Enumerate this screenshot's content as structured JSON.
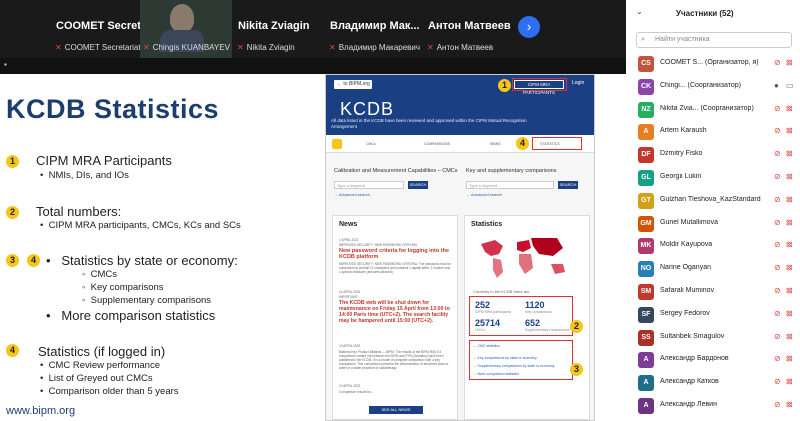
{
  "video_tiles": [
    {
      "name": "COOMET Secretariat",
      "label": "COOMET Secretariat",
      "muted": true
    },
    {
      "name": "",
      "label": "Chingis KUANBAYEV",
      "muted": true
    },
    {
      "name": "Nikita Zviagin",
      "label": "Nikita Zviagin",
      "muted": true
    },
    {
      "name": "Владимир Мак...",
      "label": "Владимир Макаревич",
      "muted": true
    },
    {
      "name": "Антон Матвеев",
      "label": "Антон Матвеев",
      "muted": true
    }
  ],
  "next_icon": "chevron-right-icon",
  "slide": {
    "title": "KCDB Statistics",
    "sections": [
      {
        "badge": "1",
        "heading": "CIPM MRA Participants",
        "bullets": [
          "NMIs, DIs, and IOs"
        ]
      },
      {
        "badge": "2",
        "heading": "Total numbers:",
        "bullets": [
          "CIPM MRA participants, CMCs, KCs and SCs"
        ]
      },
      {
        "badges": [
          "3",
          "4"
        ],
        "heading": "Statistics by state or economy:",
        "sub": [
          "CMCs",
          "Key comparisons",
          "Supplementary comparisons"
        ],
        "heading2": "More comparison statistics"
      },
      {
        "badge": "4",
        "heading": "Statistics (if logged in)",
        "bullets": [
          "CMC Review performance",
          "List of Greyed out CMCs",
          "Comparison older than 5 years"
        ]
      }
    ],
    "url": "www.bipm.org"
  },
  "website": {
    "back": "← to BIPM.org",
    "cipm_btn": "CIPM MRA PARTICIPANTS",
    "login": "Login",
    "logo": "KCDB",
    "tagline": "All data listed in the KCDB have been reviewed and approved within the CIPM Mutual Recognition Arrangement",
    "tabs": [
      "CMCs",
      "COMPARISONS",
      "NEWS",
      "STATISTICS"
    ],
    "cmc_label": "Calibration and Measurement Capabilities – CMCs",
    "cmc_placeholder": "Type a keyword",
    "comp_label": "Key and supplementary comparisons",
    "comp_placeholder": "Type a keyword",
    "search": "SEARCH",
    "advanced": "→ Advanced search",
    "news_title": "News",
    "news": [
      {
        "date": "1 APRIL 2022",
        "headline": "New password criteria for logging into the KCDB platform",
        "body": "IMPROVED SECURITY: NEW PASSWORD CRITERIA. The password must be composed by at least 12 characters and contains 1 capital letter, 1 number and 1 special character (amounts allowed)"
      },
      {
        "date": "14 APRIL 2022",
        "headline": "The KCDB web will be shut down for maintenance on Friday 15 April from 13:00 to 14:00 Paris time (UTC+2). The search facility may be hampered until 15:00 (UTC+2).",
        "body": "IMPORTANT"
      },
      {
        "date": "13 APRIL 2022",
        "headline": "",
        "body": "Bilateral Key Product Bilateral — BIPM. The results of the BIPM.RI(I)-K3 comparison carried out between the BIPM and PTB (Germany) have been published in the KCDB. It is a model of complete comparison with a key comparison. This comparison presents the determination of absorbed dose to water in a water phantom in radiotherapy"
      },
      {
        "date": "13 APRIL 2022",
        "headline": "",
        "body": "Comparison results for..."
      }
    ],
    "see_all": "SEE ALL NEWS",
    "stats_title": "Statistics",
    "stats_caption": "Currently in the KCDB there are",
    "stats": [
      {
        "value": "252",
        "label": "CIPM MRA participants"
      },
      {
        "value": "1120",
        "label": "Key comparisons"
      },
      {
        "value": "25714",
        "label": "CMCs"
      },
      {
        "value": "652",
        "label": "Supplementary comparisons"
      }
    ],
    "links": [
      "→ CMC statistics",
      "→ Key comparisons by state or economy",
      "→ Supplementary comparisons by state or economy",
      "→ More comparison statistics"
    ]
  },
  "participants": {
    "title": "Участники (52)",
    "search_placeholder": "Найти участника",
    "list": [
      {
        "initials": "CS",
        "color": "#c0563a",
        "name": "COOMET S... (Организатор, я)",
        "mic": "off",
        "cam": "off"
      },
      {
        "initials": "CK",
        "color": "#8e44ad",
        "name": "Chingi... (Соорганизатор)",
        "mic": "on",
        "cam": "on"
      },
      {
        "initials": "NZ",
        "color": "#27ae60",
        "name": "Nikita Zvia... (Соорганизатор)",
        "mic": "off",
        "cam": "off"
      },
      {
        "initials": "A",
        "color": "#e67e22",
        "name": "Artem Karaush",
        "mic": "off",
        "cam": "off"
      },
      {
        "initials": "DF",
        "color": "#c0392b",
        "name": "Dzmitry Fisko",
        "mic": "off",
        "cam": "off"
      },
      {
        "initials": "GL",
        "color": "#16a085",
        "name": "Georgii Lukin",
        "mic": "off",
        "cam": "off"
      },
      {
        "initials": "GT",
        "color": "#d4a017",
        "name": "Gulzhan Tleshova_KazStandard",
        "mic": "off",
        "cam": "off"
      },
      {
        "initials": "GM",
        "color": "#d35400",
        "name": "Gunel Mutallimova",
        "mic": "off",
        "cam": "off"
      },
      {
        "initials": "MK",
        "color": "#b03a6e",
        "name": "Moldir Kayupova",
        "mic": "off",
        "cam": "off"
      },
      {
        "initials": "NO",
        "color": "#2980b9",
        "name": "Narine Oganyan",
        "mic": "off",
        "cam": "off"
      },
      {
        "initials": "SM",
        "color": "#c0392b",
        "name": "Safarali Muminov",
        "mic": "off",
        "cam": "off"
      },
      {
        "initials": "SF",
        "color": "#34495e",
        "name": "Sergey Fedorov",
        "mic": "off",
        "cam": "off"
      },
      {
        "initials": "SS",
        "color": "#a93226",
        "name": "Sultanbek Smagulov",
        "mic": "off",
        "cam": "off"
      },
      {
        "initials": "А",
        "color": "#7d3c98",
        "name": "Александр Бардонов",
        "mic": "off",
        "cam": "off"
      },
      {
        "initials": "А",
        "color": "#1f6f8b",
        "name": "Александр Катков",
        "mic": "off",
        "cam": "off"
      },
      {
        "initials": "А",
        "color": "#6c3483",
        "name": "Александр Левин",
        "mic": "off",
        "cam": "off"
      }
    ]
  }
}
